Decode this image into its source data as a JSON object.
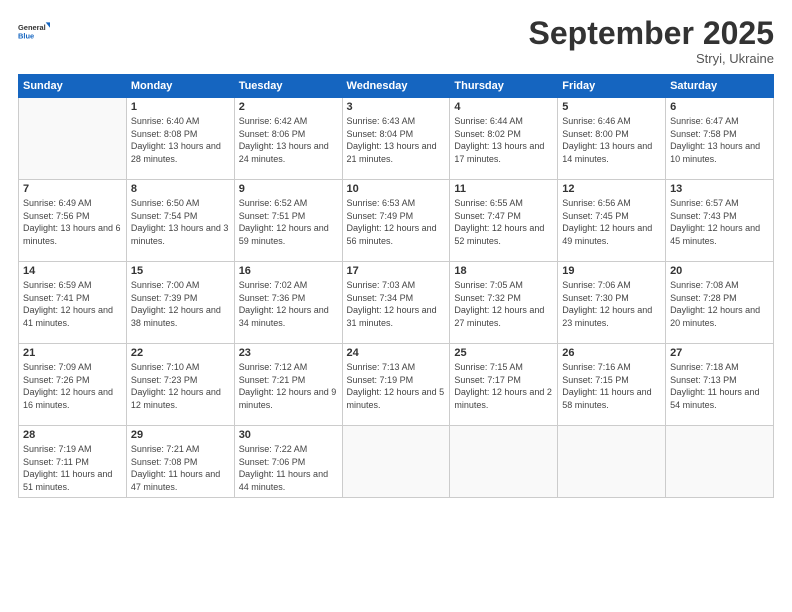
{
  "header": {
    "logo_general": "General",
    "logo_blue": "Blue",
    "month_title": "September 2025",
    "location": "Stryi, Ukraine"
  },
  "weekdays": [
    "Sunday",
    "Monday",
    "Tuesday",
    "Wednesday",
    "Thursday",
    "Friday",
    "Saturday"
  ],
  "weeks": [
    [
      {
        "day": "",
        "info": ""
      },
      {
        "day": "1",
        "info": "Sunrise: 6:40 AM\nSunset: 8:08 PM\nDaylight: 13 hours\nand 28 minutes."
      },
      {
        "day": "2",
        "info": "Sunrise: 6:42 AM\nSunset: 8:06 PM\nDaylight: 13 hours\nand 24 minutes."
      },
      {
        "day": "3",
        "info": "Sunrise: 6:43 AM\nSunset: 8:04 PM\nDaylight: 13 hours\nand 21 minutes."
      },
      {
        "day": "4",
        "info": "Sunrise: 6:44 AM\nSunset: 8:02 PM\nDaylight: 13 hours\nand 17 minutes."
      },
      {
        "day": "5",
        "info": "Sunrise: 6:46 AM\nSunset: 8:00 PM\nDaylight: 13 hours\nand 14 minutes."
      },
      {
        "day": "6",
        "info": "Sunrise: 6:47 AM\nSunset: 7:58 PM\nDaylight: 13 hours\nand 10 minutes."
      }
    ],
    [
      {
        "day": "7",
        "info": "Sunrise: 6:49 AM\nSunset: 7:56 PM\nDaylight: 13 hours\nand 6 minutes."
      },
      {
        "day": "8",
        "info": "Sunrise: 6:50 AM\nSunset: 7:54 PM\nDaylight: 13 hours\nand 3 minutes."
      },
      {
        "day": "9",
        "info": "Sunrise: 6:52 AM\nSunset: 7:51 PM\nDaylight: 12 hours\nand 59 minutes."
      },
      {
        "day": "10",
        "info": "Sunrise: 6:53 AM\nSunset: 7:49 PM\nDaylight: 12 hours\nand 56 minutes."
      },
      {
        "day": "11",
        "info": "Sunrise: 6:55 AM\nSunset: 7:47 PM\nDaylight: 12 hours\nand 52 minutes."
      },
      {
        "day": "12",
        "info": "Sunrise: 6:56 AM\nSunset: 7:45 PM\nDaylight: 12 hours\nand 49 minutes."
      },
      {
        "day": "13",
        "info": "Sunrise: 6:57 AM\nSunset: 7:43 PM\nDaylight: 12 hours\nand 45 minutes."
      }
    ],
    [
      {
        "day": "14",
        "info": "Sunrise: 6:59 AM\nSunset: 7:41 PM\nDaylight: 12 hours\nand 41 minutes."
      },
      {
        "day": "15",
        "info": "Sunrise: 7:00 AM\nSunset: 7:39 PM\nDaylight: 12 hours\nand 38 minutes."
      },
      {
        "day": "16",
        "info": "Sunrise: 7:02 AM\nSunset: 7:36 PM\nDaylight: 12 hours\nand 34 minutes."
      },
      {
        "day": "17",
        "info": "Sunrise: 7:03 AM\nSunset: 7:34 PM\nDaylight: 12 hours\nand 31 minutes."
      },
      {
        "day": "18",
        "info": "Sunrise: 7:05 AM\nSunset: 7:32 PM\nDaylight: 12 hours\nand 27 minutes."
      },
      {
        "day": "19",
        "info": "Sunrise: 7:06 AM\nSunset: 7:30 PM\nDaylight: 12 hours\nand 23 minutes."
      },
      {
        "day": "20",
        "info": "Sunrise: 7:08 AM\nSunset: 7:28 PM\nDaylight: 12 hours\nand 20 minutes."
      }
    ],
    [
      {
        "day": "21",
        "info": "Sunrise: 7:09 AM\nSunset: 7:26 PM\nDaylight: 12 hours\nand 16 minutes."
      },
      {
        "day": "22",
        "info": "Sunrise: 7:10 AM\nSunset: 7:23 PM\nDaylight: 12 hours\nand 12 minutes."
      },
      {
        "day": "23",
        "info": "Sunrise: 7:12 AM\nSunset: 7:21 PM\nDaylight: 12 hours\nand 9 minutes."
      },
      {
        "day": "24",
        "info": "Sunrise: 7:13 AM\nSunset: 7:19 PM\nDaylight: 12 hours\nand 5 minutes."
      },
      {
        "day": "25",
        "info": "Sunrise: 7:15 AM\nSunset: 7:17 PM\nDaylight: 12 hours\nand 2 minutes."
      },
      {
        "day": "26",
        "info": "Sunrise: 7:16 AM\nSunset: 7:15 PM\nDaylight: 11 hours\nand 58 minutes."
      },
      {
        "day": "27",
        "info": "Sunrise: 7:18 AM\nSunset: 7:13 PM\nDaylight: 11 hours\nand 54 minutes."
      }
    ],
    [
      {
        "day": "28",
        "info": "Sunrise: 7:19 AM\nSunset: 7:11 PM\nDaylight: 11 hours\nand 51 minutes."
      },
      {
        "day": "29",
        "info": "Sunrise: 7:21 AM\nSunset: 7:08 PM\nDaylight: 11 hours\nand 47 minutes."
      },
      {
        "day": "30",
        "info": "Sunrise: 7:22 AM\nSunset: 7:06 PM\nDaylight: 11 hours\nand 44 minutes."
      },
      {
        "day": "",
        "info": ""
      },
      {
        "day": "",
        "info": ""
      },
      {
        "day": "",
        "info": ""
      },
      {
        "day": "",
        "info": ""
      }
    ]
  ]
}
